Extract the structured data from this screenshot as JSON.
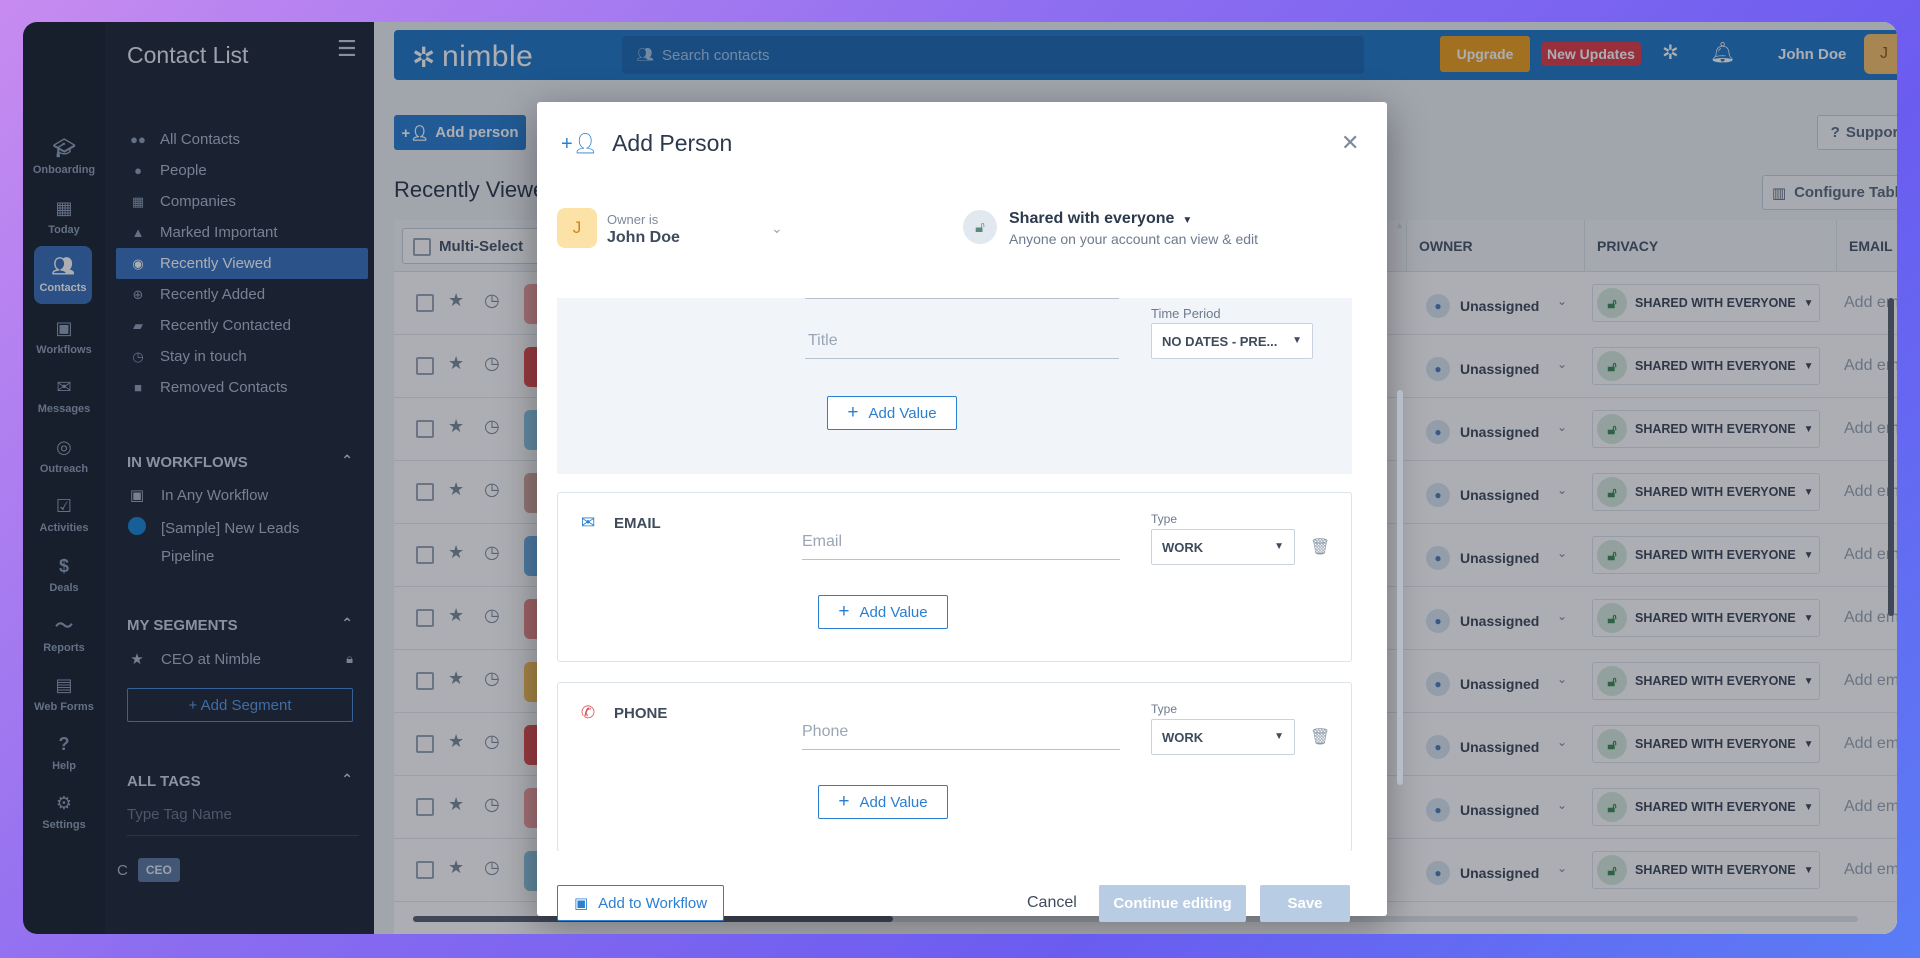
{
  "rail": {
    "items": [
      {
        "label": "Onboarding",
        "icon": "graduation-cap-icon"
      },
      {
        "label": "Today",
        "icon": "calendar-icon"
      },
      {
        "label": "Contacts",
        "icon": "people-icon"
      },
      {
        "label": "Workflows",
        "icon": "workflow-icon"
      },
      {
        "label": "Messages",
        "icon": "envelope-icon"
      },
      {
        "label": "Outreach",
        "icon": "outreach-icon"
      },
      {
        "label": "Activities",
        "icon": "activities-icon"
      },
      {
        "label": "Deals",
        "icon": "dollar-icon"
      },
      {
        "label": "Reports",
        "icon": "chart-line-icon"
      },
      {
        "label": "Web Forms",
        "icon": "form-icon"
      },
      {
        "label": "Help",
        "icon": "help-icon"
      },
      {
        "label": "Settings",
        "icon": "gear-icon"
      }
    ],
    "active": "Contacts"
  },
  "sidebar": {
    "title": "Contact List",
    "nav": [
      "All Contacts",
      "People",
      "Companies",
      "Marked Important",
      "Recently Viewed",
      "Recently Added",
      "Recently Contacted",
      "Stay in touch",
      "Removed Contacts"
    ],
    "active_nav": "Recently Viewed",
    "workflows_header": "IN WORKFLOWS",
    "workflows": [
      "In Any Workflow",
      "[Sample] New Leads",
      "Pipeline"
    ],
    "segments_header": "MY SEGMENTS",
    "segments": [
      "CEO at Nimble"
    ],
    "add_segment": "+ Add Segment",
    "tags_header": "ALL TAGS",
    "tag_placeholder": "Type Tag Name",
    "tag_prefix": "C",
    "tags": [
      "CEO"
    ]
  },
  "topbar": {
    "logo": "nimble",
    "search_placeholder": "Search contacts",
    "upgrade": "Upgrade",
    "new_updates": "New Updates",
    "user_name": "John Doe",
    "user_initial": "J"
  },
  "main": {
    "add_person": "Add person",
    "page_title": "Recently Viewed",
    "support": "Support",
    "configure_table": "Configure Table",
    "multi_select": "Multi-Select",
    "columns": [
      "OWNER",
      "PRIVACY",
      "EMAIL"
    ],
    "row_owner": "Unassigned",
    "row_privacy": "SHARED WITH EVERYONE",
    "row_email_placeholder": "Add ema",
    "avatar_colors": [
      "#f0a0a0",
      "#e05050",
      "#8ecae6",
      "#d8a9a0",
      "#6eb0e8",
      "#ea8a8a",
      "#f6c05a",
      "#e05050",
      "#f0a0a0",
      "#8ec6e0"
    ]
  },
  "modal": {
    "title": "Add Person",
    "owner_label": "Owner is",
    "owner_value": "John Doe",
    "owner_initial": "J",
    "share_title": "Shared with everyone",
    "share_subtitle": "Anyone on your account can view & edit",
    "title_placeholder": "Title",
    "time_period_label": "Time Period",
    "time_period_value": "NO DATES - PRE...",
    "add_value": "Add Value",
    "email_section": "EMAIL",
    "email_placeholder": "Email",
    "phone_section": "PHONE",
    "phone_placeholder": "Phone",
    "type_label": "Type",
    "type_value": "WORK",
    "add_to_workflow": "Add to Workflow",
    "cancel": "Cancel",
    "continue_editing": "Continue editing",
    "save": "Save"
  },
  "colors": {
    "accent": "#2a7fd0",
    "topbar": "#2178c8",
    "upgrade": "#f0a020",
    "new_updates": "#e03c4a",
    "sidebar_bg": "#1f2838",
    "active_nav": "#3973c0"
  }
}
